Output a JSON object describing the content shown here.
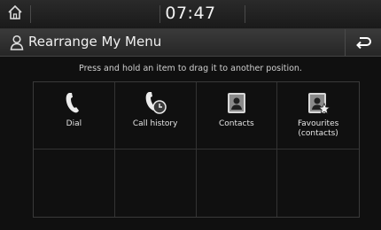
{
  "status": {
    "time": "07:47"
  },
  "header": {
    "title": "Rearrange My Menu"
  },
  "hint": "Press and hold an item to drag it to another position.",
  "menu_items": [
    {
      "label": "Dial",
      "icon": "phone-icon"
    },
    {
      "label": "Call history",
      "icon": "call-history-icon"
    },
    {
      "label": "Contacts",
      "icon": "contacts-icon"
    },
    {
      "label": "Favourites\n(contacts)",
      "icon": "favourite-contacts-icon"
    }
  ],
  "colors": {
    "background": "#101010",
    "header": "#2e2e2e",
    "text": "#e8e8e8"
  }
}
